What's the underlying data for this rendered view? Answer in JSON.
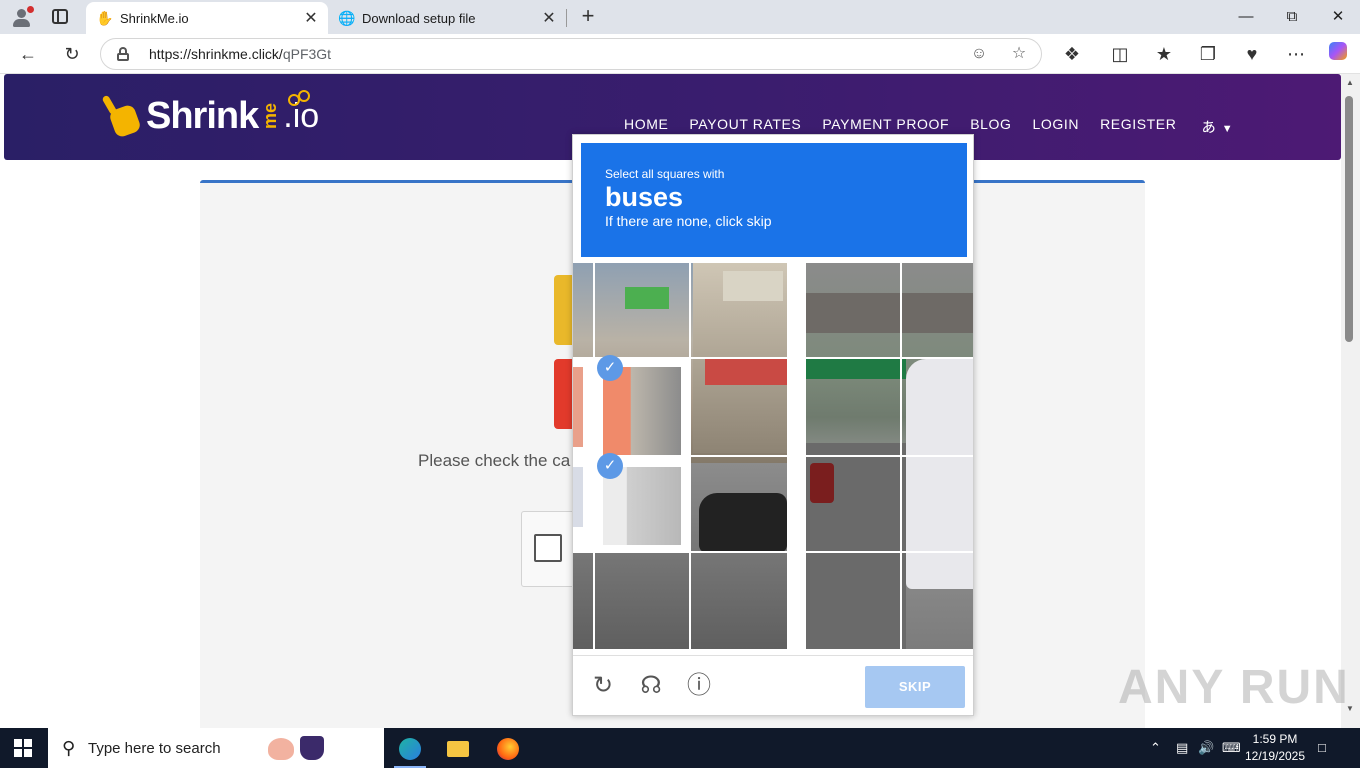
{
  "browser": {
    "tabs": [
      {
        "title": "ShrinkMe.io",
        "active": true,
        "favicon": "hand-icon"
      },
      {
        "title": "Download setup file",
        "active": false,
        "favicon": "globe-icon"
      }
    ],
    "url_domain": "https://shrinkme.click/",
    "url_path": "qPF3Gt"
  },
  "site": {
    "logo_text": "Shrink",
    "logo_me": "me",
    "logo_io": ".io",
    "nav": [
      "HOME",
      "PAYOUT RATES",
      "PAYMENT PROOF",
      "BLOG",
      "LOGIN",
      "REGISTER"
    ],
    "please_text": "Please check the ca"
  },
  "captcha": {
    "instruction": "Select all squares with",
    "target": "buses",
    "hint": "If there are none, click skip",
    "skip_label": "SKIP",
    "selected_tiles": 2
  },
  "watermark": "ANY RUN",
  "taskbar": {
    "search_placeholder": "Type here to search",
    "time": "1:59 PM",
    "date": "12/19/2025"
  },
  "colors": {
    "header_bg": "#2a1f66",
    "accent_yellow": "#f4b400",
    "captcha_blue": "#1a73e8",
    "skip_disabled": "#a6c8f2",
    "check_blue": "#5d99e6"
  }
}
